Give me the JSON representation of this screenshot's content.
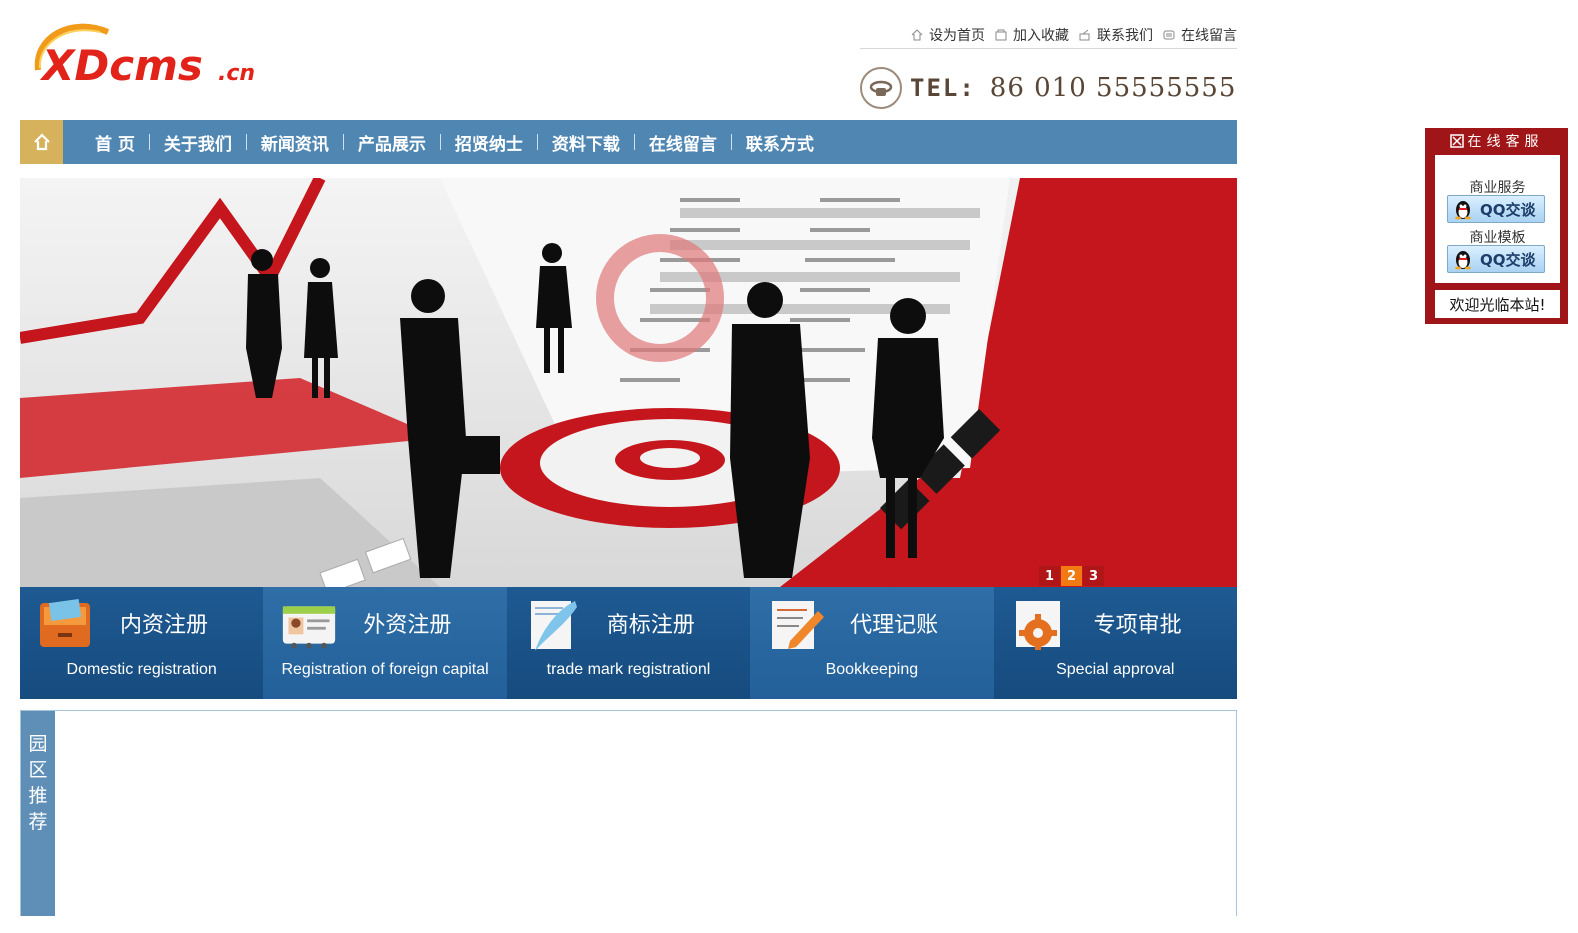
{
  "header": {
    "logo_text": "XDcms",
    "logo_suffix": ".cn",
    "top_links": [
      {
        "label": "设为首页",
        "icon": "home-icon"
      },
      {
        "label": "加入收藏",
        "icon": "bookmark-icon"
      },
      {
        "label": "联系我们",
        "icon": "contact-icon"
      },
      {
        "label": "在线留言",
        "icon": "message-icon"
      }
    ],
    "tel_label": "TEL:",
    "tel_number": "86 010 55555555"
  },
  "nav": {
    "home_icon": "home-icon",
    "items": [
      "首 页",
      "关于我们",
      "新闻资讯",
      "产品展示",
      "招贤纳士",
      "资料下载",
      "在线留言",
      "联系方式"
    ]
  },
  "banner": {
    "pages": [
      "1",
      "2",
      "3"
    ],
    "active_page": "2"
  },
  "services": [
    {
      "title": "内资注册",
      "subtitle": "Domestic registration",
      "icon": "cabinet-icon"
    },
    {
      "title": "外资注册",
      "subtitle": "Registration of foreign capital",
      "icon": "id-card-icon"
    },
    {
      "title": "商标注册",
      "subtitle": "trade mark registrationl",
      "icon": "quill-icon"
    },
    {
      "title": "代理记账",
      "subtitle": "Bookkeeping",
      "icon": "pencil-document-icon"
    },
    {
      "title": "专项审批",
      "subtitle": "Special approval",
      "icon": "gear-icon"
    }
  ],
  "recommend": {
    "title": "园区推荐"
  },
  "online_service": {
    "title": "在线客服",
    "groups": [
      {
        "label": "商业服务",
        "button": "QQ交谈"
      },
      {
        "label": "商业模板",
        "button": "QQ交谈"
      }
    ],
    "footer": "欢迎光临本站!"
  },
  "colors": {
    "nav_bg": "#4f86b2",
    "nav_home_bg": "#d6b25c",
    "service_dark": "#1e5a92",
    "service_light": "#2f6ea6",
    "widget_red": "#a01618",
    "pager_red": "#b01518",
    "pager_active": "#f27a12"
  }
}
